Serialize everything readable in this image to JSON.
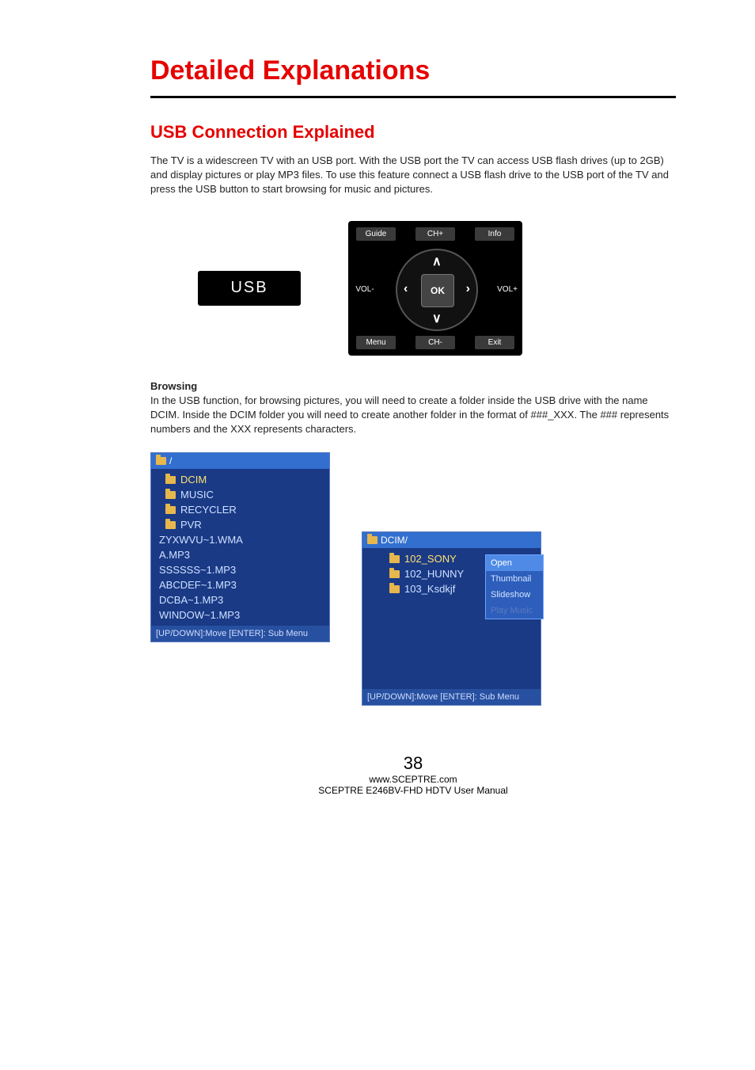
{
  "title": "Detailed Explanations",
  "subtitle": "USB Connection Explained",
  "intro": "The TV is a widescreen TV with an USB port.  With the USB port the TV can access USB flash drives (up to 2GB) and display pictures or play MP3 files.  To use this feature connect a USB flash drive to the USB port of the TV and press the USB button to start browsing for music and pictures.",
  "usb_label": "USB",
  "remote": {
    "guide": "Guide",
    "chp": "CH+",
    "info": "Info",
    "voll": "VOL-",
    "volr": "VOL+",
    "ok": "OK",
    "menu": "Menu",
    "chm": "CH-",
    "exit": "Exit",
    "up": "∧",
    "down": "∨",
    "left": "‹",
    "right": "›"
  },
  "browsing_heading": "Browsing",
  "browsing_body": "In the USB function, for browsing pictures, you will need to create a folder inside the USB drive with the name DCIM.  Inside the DCIM folder you will need to create another folder in the format of ###_XXX.  The ### represents numbers and the XXX represents characters.",
  "panel_left": {
    "header": "/",
    "items": [
      "DCIM",
      "MUSIC",
      "RECYCLER",
      "PVR",
      "ZYXWVU~1.WMA",
      "A.MP3",
      "SSSSSS~1.MP3",
      "ABCDEF~1.MP3",
      "DCBA~1.MP3",
      "WINDOW~1.MP3"
    ],
    "footer": "[UP/DOWN]:Move [ENTER]: Sub Menu"
  },
  "panel_right": {
    "header": "DCIM/",
    "items": [
      "102_SONY",
      "102_HUNNY",
      "103_Ksdkjf"
    ],
    "context": {
      "open": "Open",
      "thumbnail": "Thumbnail",
      "slideshow": "Slideshow",
      "play": "Play Music"
    },
    "footer": "[UP/DOWN]:Move [ENTER]: Sub Menu"
  },
  "footer": {
    "page": "38",
    "url": "www.SCEPTRE.com",
    "model": "SCEPTRE E246BV-FHD HDTV User Manual"
  }
}
